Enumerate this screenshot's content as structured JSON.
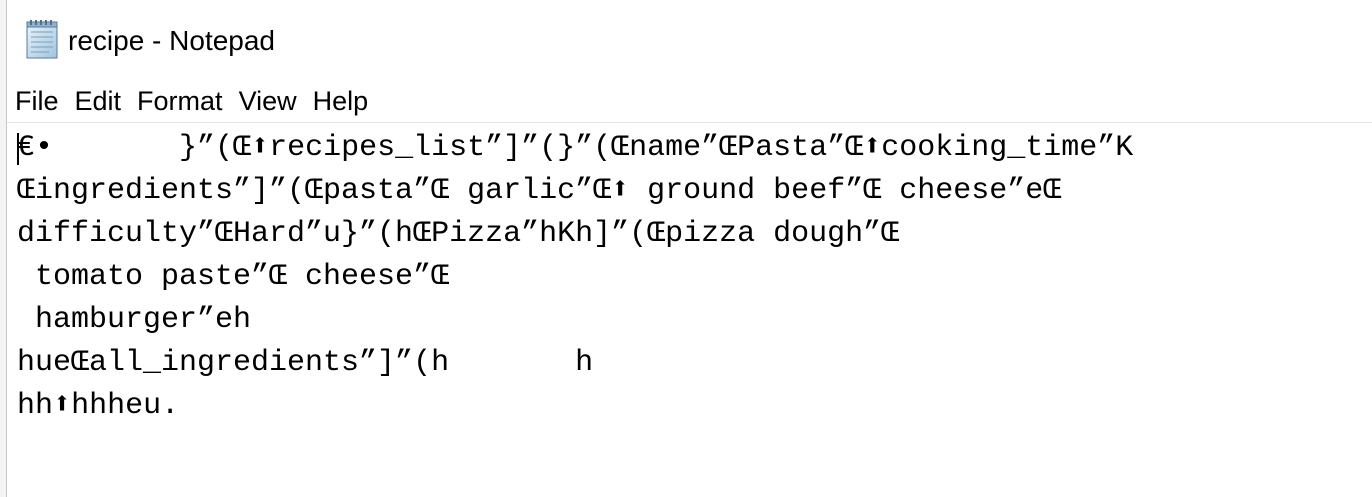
{
  "window": {
    "title": "recipe - Notepad",
    "app_icon": "notepad-icon"
  },
  "menu": {
    "items": [
      "File",
      "Edit",
      "Format",
      "View",
      "Help"
    ]
  },
  "editor": {
    "lines": [
      "€\u0003• \u0000      }”(Œ⬆recipes_list”]”(}”(Œ\u0004name”Œ\u0005Pasta”Œ⬆cooking_time”K",
      "Œ\u000bingredients”]”(Œ\u0005pasta”Œ\u0006 garlic”Œ⬆ ground beef”Œ\u0006 cheese”eŒ",
      "difficulty”Œ\u0004Hard”u}”(h\u0006Œ\u0005Pizza”h\u0007K\u0014h\b]”(Œ\u000bpizza dough”Œ",
      " tomato paste”Œ\u0006 cheese”Œ",
      " hamburger”eh",
      "h\u0010ueŒ\u000fall_ingredients”]”(h       h",
      "h\u0011h⬆h\u0012h\u0013h\u0014eu."
    ]
  }
}
